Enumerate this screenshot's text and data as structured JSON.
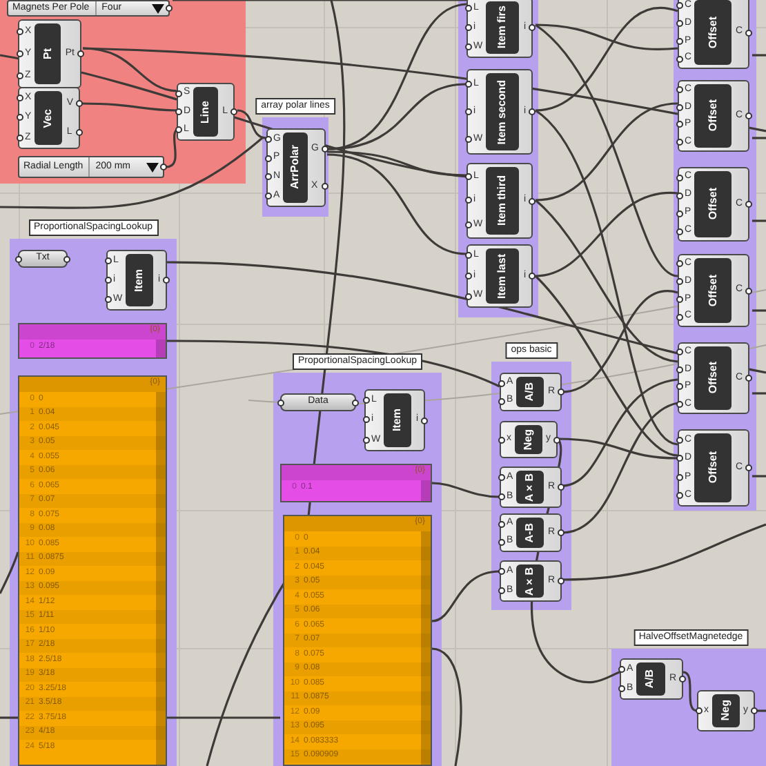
{
  "groups": [
    {
      "color": "#f08282"
    },
    {
      "label": "array polar lines",
      "color": "#b7a0ee"
    },
    {
      "color": "#b7a0ee"
    },
    {
      "color": "#b7a0ee"
    },
    {
      "label": "ProportionalSpacingLookup",
      "color": "#b7a0ee"
    },
    {
      "label": "ProportionalSpacingLookup",
      "color": "#b7a0ee"
    },
    {
      "label": "ops basic",
      "color": "#b7a0ee"
    },
    {
      "label": "HalveOffsetMagnetedge",
      "color": "#b7a0ee"
    }
  ],
  "nodes": [
    {
      "kind": "valuelist",
      "label": "Magnets Per Pole",
      "value": "Four"
    },
    {
      "kind": "component",
      "name": "Pt",
      "inputs": [
        "X",
        "Y",
        "Z"
      ],
      "outputs": [
        "Pt"
      ]
    },
    {
      "kind": "component",
      "name": "Vec",
      "inputs": [
        "X",
        "Y",
        "Z"
      ],
      "outputs": [
        "V",
        "L"
      ]
    },
    {
      "kind": "component",
      "name": "Line",
      "inputs": [
        "S",
        "D",
        "L"
      ],
      "outputs": [
        "L"
      ]
    },
    {
      "kind": "valuelist",
      "label": "Radial Length",
      "value": "200 mm"
    },
    {
      "kind": "component",
      "name": "ArrPolar",
      "inputs": [
        "G",
        "P",
        "N",
        "A"
      ],
      "outputs": [
        "G",
        "X"
      ]
    },
    {
      "kind": "component",
      "name": "Item firs",
      "inputs": [
        "L",
        "i",
        "W"
      ],
      "outputs": [
        "i"
      ]
    },
    {
      "kind": "component",
      "name": "Item second",
      "inputs": [
        "L",
        "i",
        "W"
      ],
      "outputs": [
        "i"
      ]
    },
    {
      "kind": "component",
      "name": "Item third",
      "inputs": [
        "L",
        "i",
        "W"
      ],
      "outputs": [
        "i"
      ]
    },
    {
      "kind": "component",
      "name": "Item last",
      "inputs": [
        "L",
        "i",
        "W"
      ],
      "outputs": [
        "i"
      ]
    },
    {
      "kind": "component",
      "name": "Offset",
      "inputs": [
        "C",
        "D",
        "P",
        "C"
      ],
      "outputs": [
        "C"
      ]
    },
    {
      "kind": "component",
      "name": "Offset",
      "inputs": [
        "C",
        "D",
        "P",
        "C"
      ],
      "outputs": [
        "C"
      ]
    },
    {
      "kind": "component",
      "name": "Offset",
      "inputs": [
        "C",
        "D",
        "P",
        "C"
      ],
      "outputs": [
        "C"
      ]
    },
    {
      "kind": "component",
      "name": "Offset",
      "inputs": [
        "C",
        "D",
        "P",
        "C"
      ],
      "outputs": [
        "C"
      ]
    },
    {
      "kind": "component",
      "name": "Offset",
      "inputs": [
        "C",
        "D",
        "P",
        "C"
      ],
      "outputs": [
        "C"
      ]
    },
    {
      "kind": "component",
      "name": "Offset",
      "inputs": [
        "C",
        "D",
        "P",
        "C"
      ],
      "outputs": [
        "C"
      ]
    },
    {
      "kind": "param",
      "name": "Txt"
    },
    {
      "kind": "component",
      "name": "Item",
      "inputs": [
        "L",
        "i",
        "W"
      ],
      "outputs": [
        "i"
      ]
    },
    {
      "kind": "panel",
      "color": "#e44de6",
      "header": "{0}",
      "rows": [
        {
          "index": "0",
          "value": "2/18"
        }
      ]
    },
    {
      "kind": "panel",
      "color": "#f7a800",
      "header": "{0}",
      "rows": [
        {
          "index": "0",
          "value": "0"
        },
        {
          "index": "1",
          "value": "0.04"
        },
        {
          "index": "2",
          "value": "0.045"
        },
        {
          "index": "3",
          "value": "0.05"
        },
        {
          "index": "4",
          "value": "0.055"
        },
        {
          "index": "5",
          "value": "0.06"
        },
        {
          "index": "6",
          "value": "0.065"
        },
        {
          "index": "7",
          "value": "0.07"
        },
        {
          "index": "8",
          "value": "0.075"
        },
        {
          "index": "9",
          "value": "0.08"
        },
        {
          "index": "10",
          "value": "0.085"
        },
        {
          "index": "11",
          "value": "0.0875"
        },
        {
          "index": "12",
          "value": "0.09"
        },
        {
          "index": "13",
          "value": "0.095"
        },
        {
          "index": "14",
          "value": "1/12"
        },
        {
          "index": "15",
          "value": "1/11"
        },
        {
          "index": "16",
          "value": "1/10"
        },
        {
          "index": "17",
          "value": "2/18"
        },
        {
          "index": "18",
          "value": "2.5/18"
        },
        {
          "index": "19",
          "value": "3/18"
        },
        {
          "index": "20",
          "value": "3.25/18"
        },
        {
          "index": "21",
          "value": "3.5/18"
        },
        {
          "index": "22",
          "value": "3.75/18"
        },
        {
          "index": "23",
          "value": "4/18"
        },
        {
          "index": "24",
          "value": "5/18"
        }
      ]
    },
    {
      "kind": "param",
      "name": "Data"
    },
    {
      "kind": "component",
      "name": "Item",
      "inputs": [
        "L",
        "i",
        "W"
      ],
      "outputs": [
        "i"
      ]
    },
    {
      "kind": "panel",
      "color": "#e44de6",
      "header": "{0}",
      "rows": [
        {
          "index": "0",
          "value": "0.1"
        }
      ]
    },
    {
      "kind": "panel",
      "color": "#f7a800",
      "header": "{0}",
      "rows": [
        {
          "index": "0",
          "value": "0"
        },
        {
          "index": "1",
          "value": "0.04"
        },
        {
          "index": "2",
          "value": "0.045"
        },
        {
          "index": "3",
          "value": "0.05"
        },
        {
          "index": "4",
          "value": "0.055"
        },
        {
          "index": "5",
          "value": "0.06"
        },
        {
          "index": "6",
          "value": "0.065"
        },
        {
          "index": "7",
          "value": "0.07"
        },
        {
          "index": "8",
          "value": "0.075"
        },
        {
          "index": "9",
          "value": "0.08"
        },
        {
          "index": "10",
          "value": "0.085"
        },
        {
          "index": "11",
          "value": "0.0875"
        },
        {
          "index": "12",
          "value": "0.09"
        },
        {
          "index": "13",
          "value": "0.095"
        },
        {
          "index": "14",
          "value": "0.083333"
        },
        {
          "index": "15",
          "value": "0.090909"
        }
      ]
    },
    {
      "kind": "component",
      "name": "A/B",
      "inputs": [
        "A",
        "B"
      ],
      "outputs": [
        "R"
      ]
    },
    {
      "kind": "component",
      "name": "Neg",
      "inputs": [
        "x"
      ],
      "outputs": [
        "y"
      ]
    },
    {
      "kind": "component",
      "name": "A×B",
      "inputs": [
        "A",
        "B"
      ],
      "outputs": [
        "R"
      ]
    },
    {
      "kind": "component",
      "name": "A-B",
      "inputs": [
        "A",
        "B"
      ],
      "outputs": [
        "R"
      ]
    },
    {
      "kind": "component",
      "name": "A×B",
      "inputs": [
        "A",
        "B"
      ],
      "outputs": [
        "R"
      ]
    },
    {
      "kind": "component",
      "name": "A/B",
      "inputs": [
        "A",
        "B"
      ],
      "outputs": [
        "R"
      ]
    },
    {
      "kind": "component",
      "name": "Neg",
      "inputs": [
        "x"
      ],
      "outputs": [
        "y"
      ]
    }
  ]
}
